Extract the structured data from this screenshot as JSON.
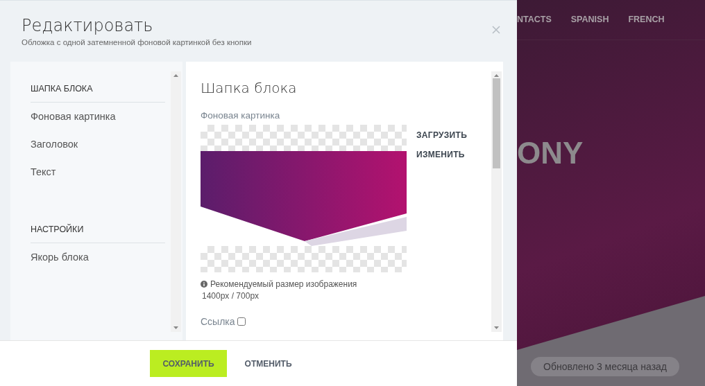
{
  "dialog": {
    "title": "Редактировать",
    "subtitle": "Обложка с одной затемненной фоновой картинкой без кнопки"
  },
  "sidebar": {
    "sections": [
      {
        "title": "ШАПКА БЛОКА",
        "items": [
          {
            "label": "Фоновая картинка"
          },
          {
            "label": "Заголовок"
          },
          {
            "label": "Текст"
          }
        ]
      },
      {
        "title": "НАСТРОЙКИ",
        "items": [
          {
            "label": "Якорь блока"
          }
        ]
      }
    ]
  },
  "content": {
    "title": "Шапка блока",
    "field_label": "Фоновая картинка",
    "actions": [
      "ЗАГРУЗИТЬ",
      "ИЗМЕНИТЬ"
    ],
    "hint": "Рекомендуемый размер изображения",
    "size": "1400px / 700px",
    "link": {
      "label": "Ссылка",
      "checked": false
    }
  },
  "footer": {
    "buttons": [
      {
        "label": "СОХРАНИТЬ",
        "kind": "primary"
      },
      {
        "label": "ОТМЕНИТЬ",
        "kind": "plain"
      }
    ]
  },
  "site": {
    "nav": [
      "NTACTS",
      "SPANISH",
      "FRENCH"
    ],
    "headline": "ONY",
    "updated": "Обновлено 3 месяца назад"
  }
}
